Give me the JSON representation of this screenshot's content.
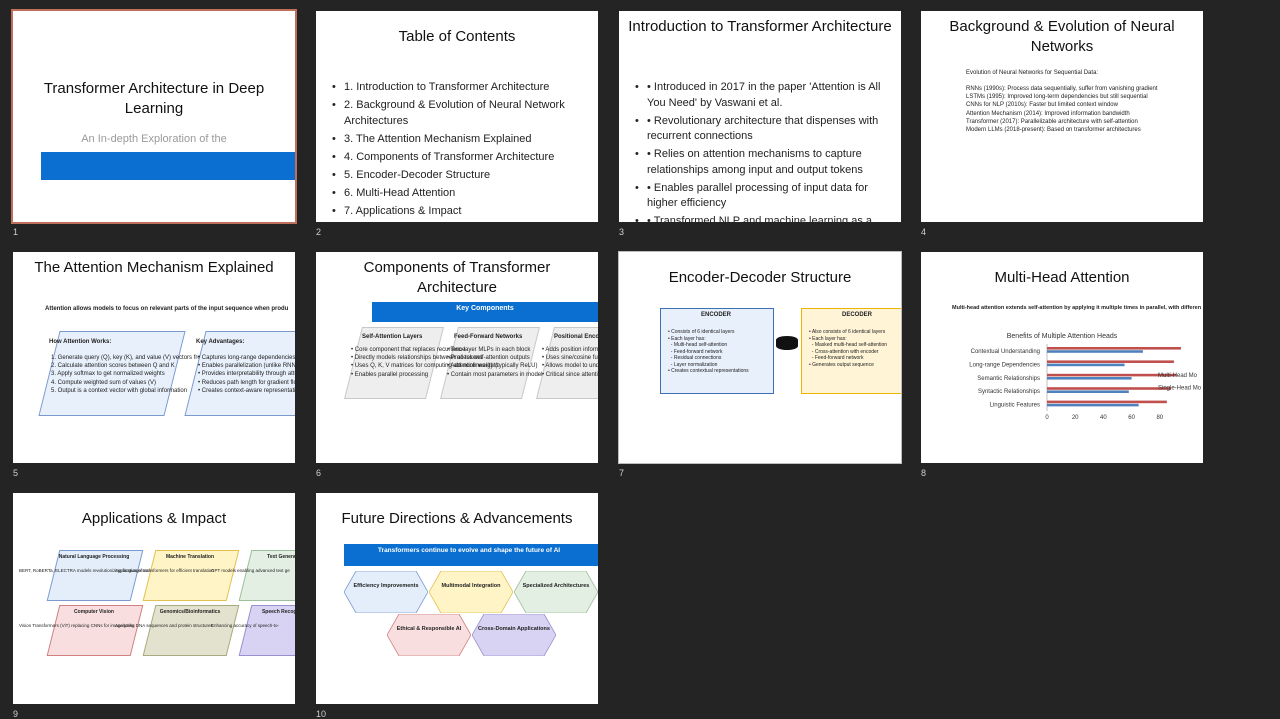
{
  "slides": [
    {
      "number": "1",
      "title": "Transformer Architecture in Deep Learning",
      "subtitle": "An In-depth Exploration of the"
    },
    {
      "number": "2",
      "title": "Table of Contents",
      "items": [
        "1. Introduction to Transformer Architecture",
        "2. Background & Evolution of Neural Network Architectures",
        "3. The Attention Mechanism Explained",
        "4. Components of Transformer Architecture",
        "5. Encoder-Decoder Structure",
        "6. Multi-Head Attention",
        "7. Applications & Impact"
      ]
    },
    {
      "number": "3",
      "title": "Introduction to Transformer Architecture",
      "items": [
        "• Introduced in 2017 in the paper 'Attention is All You Need' by Vaswani et al.",
        "• Revolutionary architecture that dispenses with recurrent connections",
        "• Relies on attention mechanisms to capture relationships among input and output tokens",
        "• Enables parallel processing of input data for higher efficiency",
        "• Transformed NLP and machine learning as a"
      ]
    },
    {
      "number": "4",
      "title": "Background & Evolution of Neural Networks",
      "heading": "Evolution of Neural Networks for Sequential Data:",
      "items": [
        "RNNs (1990s): Process data sequentially, suffer from vanishing gradient",
        "LSTMs (1995): Improved long-term dependencies but still sequential",
        "CNNs for NLP (2010s): Faster but limited context window",
        "Attention Mechanism (2014): Improved information bandwidth",
        "Transformer (2017): Parallelizable architecture with self-attention",
        "Modern LLMs (2018-present): Based on transformer architectures"
      ]
    },
    {
      "number": "5",
      "title": "The Attention Mechanism Explained",
      "intro": "Attention allows models to focus on relevant parts of the input sequence when produ",
      "box1_title": "How Attention Works:",
      "box1_items": [
        "1. Generate query (Q), key (K), and value (V) vectors from input",
        "2. Calculate attention scores between Q and K",
        "3. Apply softmax to get normalized weights",
        "4. Compute weighted sum of values (V)",
        "5. Output is a context vector with global information"
      ],
      "box2_title": "Key Advantages:",
      "box2_items": [
        "• Captures long-range dependencies in a sin",
        "• Enables parallelization (unlike RNNs)",
        "• Provides interpretability through attention",
        "• Reduces path length for gradient flow",
        "• Creates context-aware representations"
      ]
    },
    {
      "number": "6",
      "title": "Components of Transformer Architecture",
      "banner": "Key Components",
      "cols": [
        {
          "title": "Self-Attention Layers",
          "items": [
            "• Core component that replaces recurrence",
            "• Directly models relationships between all tokens",
            "• Uses Q, K, V matrices for computing attention weights",
            "• Enables parallel processing"
          ]
        },
        {
          "title": "Feed-Forward Networks",
          "items": [
            "• Two-layer MLPs in each block",
            "• Process self-attention outputs",
            "• Add nonlinearity (typically ReLU)",
            "• Contain most parameters in model"
          ]
        },
        {
          "title": "Positional Encod",
          "items": [
            "• Adds position informati",
            "• Uses sine/cosine functi",
            "• Allows model to unders",
            "• Critical since attention i"
          ]
        }
      ]
    },
    {
      "number": "7",
      "title": "Encoder-Decoder Structure",
      "encoder_title": "ENCODER",
      "encoder_items": [
        "• Consists of 6 identical layers",
        "• Each layer has:",
        "  - Multi-head self-attention",
        "  - Feed-forward network",
        "  - Residual connections",
        "  - Layer normalization",
        "• Creates contextual representations"
      ],
      "decoder_title": "DECODER",
      "decoder_items": [
        "• Also consists of 6 identical layers",
        "• Each layer has:",
        "  - Masked multi-head self-attention",
        "  - Cross-attention with encoder",
        "  - Feed-forward network",
        "• Generates output sequence"
      ]
    },
    {
      "number": "8",
      "title": "Multi-Head Attention",
      "intro": "Multi-head attention extends self-attention by applying it multiple times in parallel, with differen"
    },
    {
      "number": "9",
      "title": "Applications & Impact",
      "cards": [
        {
          "title": "Natural Language Processing",
          "desc": "BERT, RoBERTa, ELECTRA models revolutionizing language understanding"
        },
        {
          "title": "Machine Translation",
          "desc": "Application of transformers for efficient translation"
        },
        {
          "title": "Text Generation",
          "desc": "GPT models enabling advanced text ge"
        },
        {
          "title": "Computer Vision",
          "desc": "Vision Transformers (ViT) replacing CNNs for image tasks"
        },
        {
          "title": "Genomics/Bioinformatics",
          "desc": "Analyzing DNA sequences and protein structures"
        },
        {
          "title": "Speech Recognition",
          "desc": "Enhancing accuracy of speech-to-"
        }
      ]
    },
    {
      "number": "10",
      "title": "Future Directions & Advancements",
      "banner": "Transformers continue to evolve and shape the future of AI",
      "hexes": [
        "Efficiency Improvements",
        "Multimodal Integration",
        "Specialized Architectures",
        "Ethical & Responsible AI",
        "Cross-Domain Applications"
      ]
    }
  ],
  "chart_data": {
    "type": "bar",
    "orientation": "horizontal",
    "title": "Benefits of Multiple Attention Heads",
    "categories": [
      "Contextual Understanding",
      "Long-range Dependencies",
      "Semantic Relationships",
      "Syntactic Relationships",
      "Linguistic Features"
    ],
    "series": [
      {
        "name": "Multi-Head Mo",
        "values": [
          95,
          90,
          92,
          88,
          85
        ]
      },
      {
        "name": "Single-Head Mo",
        "values": [
          68,
          55,
          60,
          58,
          65
        ]
      }
    ],
    "xticks": [
      "0",
      "20",
      "40",
      "60",
      "80"
    ],
    "xlim": [
      0,
      100
    ],
    "colors": [
      "#c0504d",
      "#4f81bd"
    ]
  }
}
